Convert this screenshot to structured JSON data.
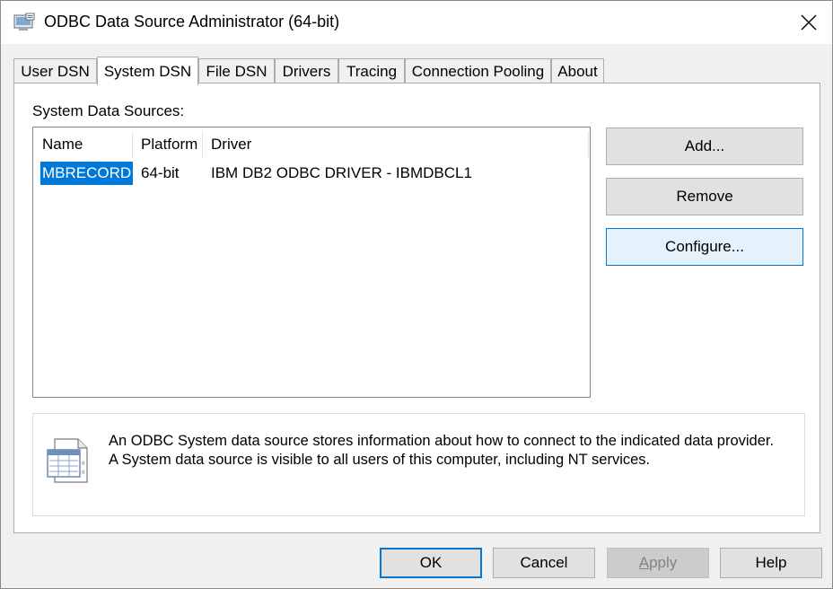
{
  "window": {
    "title": "ODBC Data Source Administrator (64-bit)",
    "icon": "odbc-admin-icon"
  },
  "tabs": [
    {
      "label": "User DSN"
    },
    {
      "label": "System DSN"
    },
    {
      "label": "File DSN"
    },
    {
      "label": "Drivers"
    },
    {
      "label": "Tracing"
    },
    {
      "label": "Connection Pooling"
    },
    {
      "label": "About"
    }
  ],
  "active_tab": "System DSN",
  "list": {
    "label": "System Data Sources:",
    "columns": [
      "Name",
      "Platform",
      "Driver"
    ],
    "rows": [
      {
        "name": "MBRECORD",
        "platform": "64-bit",
        "driver": "IBM DB2 ODBC DRIVER - IBMDBCL1",
        "selected": true
      }
    ]
  },
  "buttons": {
    "add": "Add...",
    "remove": "Remove",
    "configure": "Configure..."
  },
  "info": {
    "line1": "An ODBC System data source stores information about how to connect to the indicated data provider.",
    "line2": "A System data source is visible to all users of this computer, including NT services.",
    "icon": "data-source-document-icon"
  },
  "footer": {
    "ok": "OK",
    "cancel": "Cancel",
    "apply_first": "A",
    "apply_rest": "pply",
    "help": "Help"
  },
  "colors": {
    "selection": "#0078d7",
    "focus_border": "#0078d7"
  }
}
